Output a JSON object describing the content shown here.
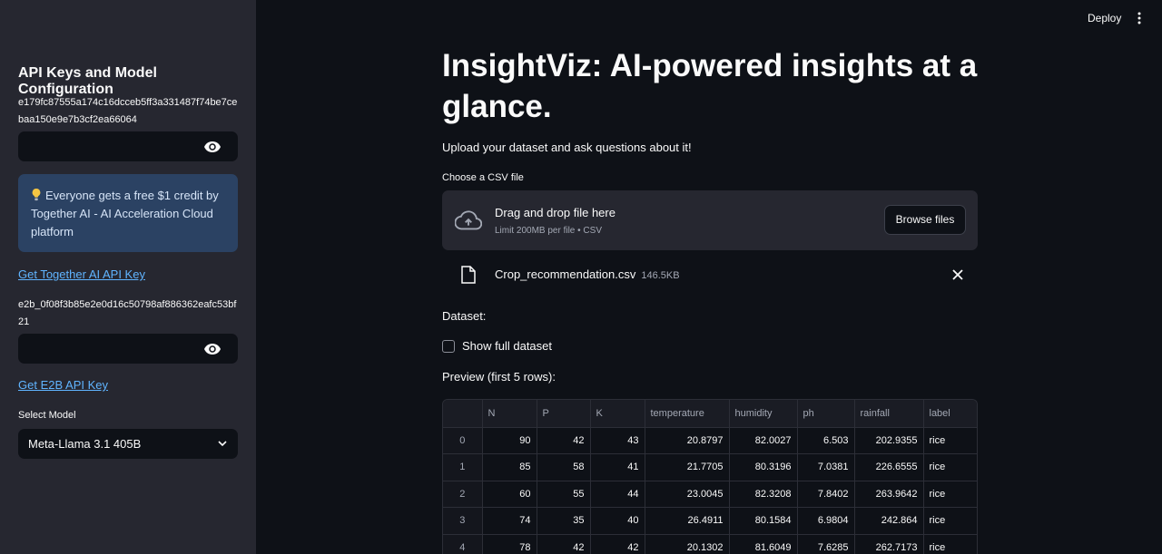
{
  "sidebar": {
    "title": "API Keys and Model Configuration",
    "together_key_label": "e179fc87555a174c16dcceb5ff3a331487f74be7cebaa150e9e7b3cf2ea66064",
    "together_key_value": "",
    "info_text": "Everyone gets a free $1 credit by Together AI - AI Acceleration Cloud platform",
    "together_link": "Get Together AI API Key",
    "e2b_key_label": "e2b_0f08f3b85e2e0d16c50798af886362eafc53bf21",
    "e2b_key_value": "",
    "e2b_link": "Get E2B API Key",
    "select_label": "Select Model",
    "select_value": "Meta-Llama 3.1 405B"
  },
  "header": {
    "deploy_label": "Deploy"
  },
  "main": {
    "title": "InsightViz: AI-powered insights at a glance.",
    "subtitle": "Upload your dataset and ask questions about it!",
    "upload_label": "Choose a CSV file",
    "dropzone_main": "Drag and drop file here",
    "dropzone_sub": "Limit 200MB per file • CSV",
    "browse_label": "Browse files",
    "file_name": "Crop_recommendation.csv",
    "file_size": "146.5KB",
    "dataset_label": "Dataset:",
    "checkbox_label": "Show full dataset",
    "preview_label": "Preview (first 5 rows):"
  },
  "table": {
    "columns": [
      "",
      "N",
      "P",
      "K",
      "temperature",
      "humidity",
      "ph",
      "rainfall",
      "label"
    ],
    "rows": [
      [
        "0",
        "90",
        "42",
        "43",
        "20.8797",
        "82.0027",
        "6.503",
        "202.9355",
        "rice"
      ],
      [
        "1",
        "85",
        "58",
        "41",
        "21.7705",
        "80.3196",
        "7.0381",
        "226.6555",
        "rice"
      ],
      [
        "2",
        "60",
        "55",
        "44",
        "23.0045",
        "82.3208",
        "7.8402",
        "263.9642",
        "rice"
      ],
      [
        "3",
        "74",
        "35",
        "40",
        "26.4911",
        "80.1584",
        "6.9804",
        "242.864",
        "rice"
      ],
      [
        "4",
        "78",
        "42",
        "42",
        "20.1302",
        "81.6049",
        "7.6285",
        "262.7173",
        "rice"
      ]
    ]
  },
  "icons": {
    "eye": "eye-icon",
    "bulb": "lightbulb-icon",
    "chevron": "chevron-down-icon",
    "cloud": "cloud-upload-icon",
    "file": "file-icon",
    "close": "close-icon",
    "menu": "more-vertical-icon"
  },
  "colors": {
    "background": "#0e1117",
    "sidebar": "#262730",
    "info_box": "#2b4263",
    "link": "#60b4ff"
  }
}
